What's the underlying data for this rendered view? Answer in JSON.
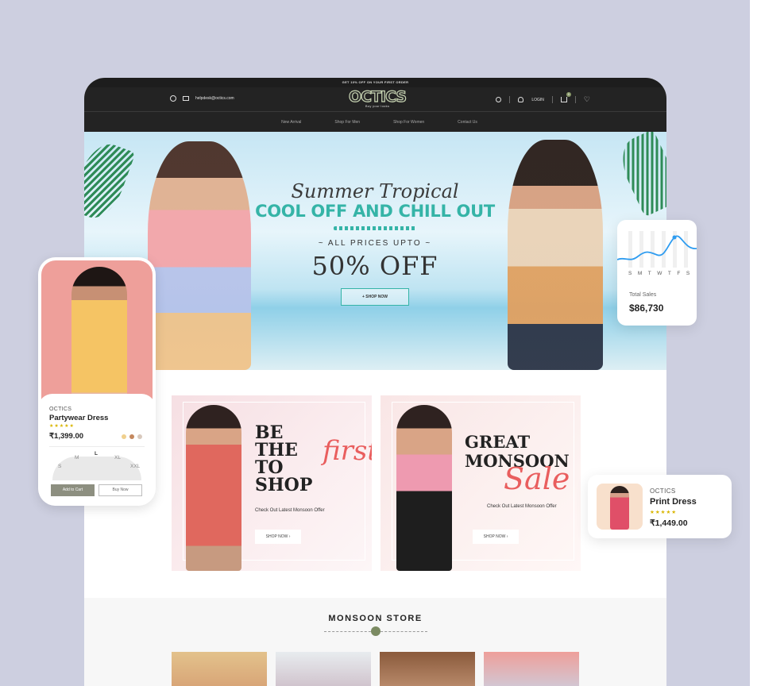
{
  "promo_bar": "GET 10% OFF ON YOUR FIRST ORDER",
  "header": {
    "email": "helpdesk@octics.com",
    "logo": "OCTICS",
    "tagline": "Buy your looks",
    "login": "LOGIN",
    "cart_count": "0"
  },
  "nav": [
    "New Arrival",
    "Shop For Men",
    "Shop For Women",
    "Contact Us"
  ],
  "hero": {
    "script": "Summer Tropical",
    "headline": "COOL OFF AND CHILL OUT",
    "prices": "~ ALL PRICES UPTO ~",
    "discount": "50% OFF",
    "cta": "+ SHOP NOW"
  },
  "offers": [
    {
      "title": "BE\nTHE\nTO\nSHOP",
      "accent": "first",
      "subtitle": "Check Out Latest Monsoon Offer",
      "cta": "SHOP NOW ›"
    },
    {
      "title": "GREAT\nMONSOON",
      "accent": "Sale",
      "subtitle": "Check Out Latest Monsoon Offer",
      "cta": "SHOP NOW ›"
    }
  ],
  "store": {
    "title": "MONSOON STORE"
  },
  "product_card": {
    "brand": "OCTICS",
    "name": "Partywear Dress",
    "stars": "★★★★★",
    "price": "₹1,399.00",
    "swatches": [
      "#f0d08e",
      "#c4885e",
      "#d8c9bd"
    ],
    "sizes": [
      "S",
      "M",
      "L",
      "XL",
      "XXL"
    ],
    "selected_size": "L",
    "add_to_cart": "Add to Cart",
    "buy_now": "Buy Now"
  },
  "sales_card": {
    "days": [
      "S",
      "M",
      "T",
      "W",
      "T",
      "F",
      "S"
    ],
    "label": "Total Sales",
    "value": "$86,730"
  },
  "print_card": {
    "brand": "OCTICS",
    "name": "Print Dress",
    "stars": "★★★★★",
    "price": "₹1,449.00"
  },
  "colors": {
    "page_bg": "#cdcfe0",
    "header_bg": "#232323",
    "teal": "#35b4a7",
    "accent_red": "#e95e5e",
    "olive": "#7b8a62"
  }
}
